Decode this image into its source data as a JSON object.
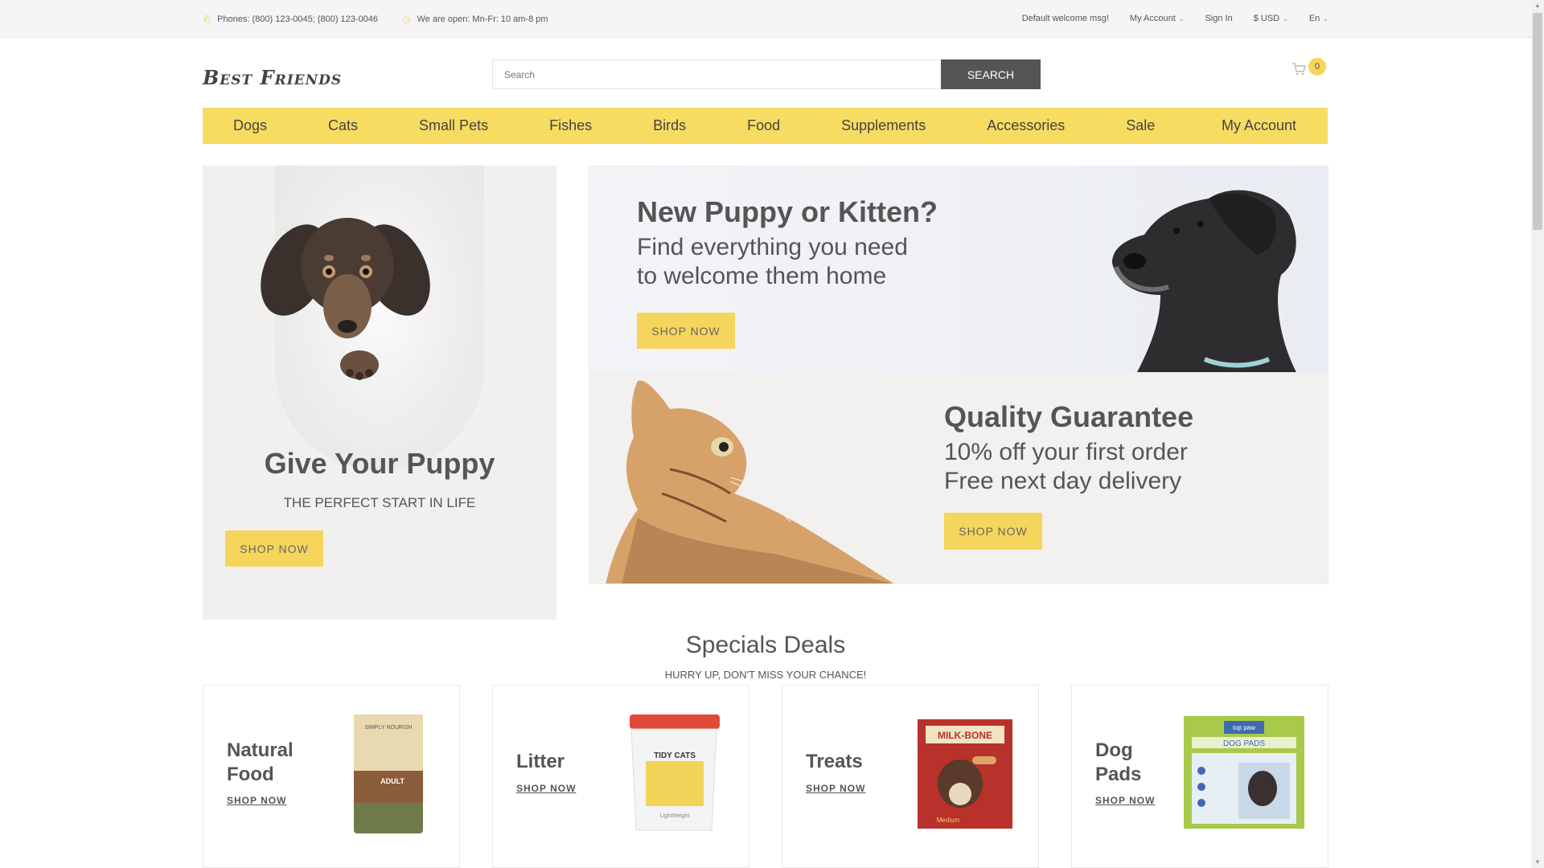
{
  "topbar": {
    "phones": "Phones: (800) 123-0045; (800) 123-0046",
    "hours": "We are open: Mn-Fr: 10 am-8 pm",
    "welcome": "Default welcome msg!",
    "my_account": "My Account",
    "sign_in": "Sign In",
    "currency": "$ USD",
    "language": "En"
  },
  "header": {
    "logo": "Best Friends",
    "search_placeholder": "Search",
    "search_button": "SEARCH",
    "cart_count": "0"
  },
  "nav": {
    "items": [
      "Dogs",
      "Cats",
      "Small Pets",
      "Fishes",
      "Birds",
      "Food",
      "Supplements",
      "Accessories",
      "Sale"
    ],
    "account": "My Account"
  },
  "hero_left": {
    "title": "Give Your Puppy",
    "subtitle": "THE PERFECT START IN LIFE",
    "button": "SHOP NOW"
  },
  "hero_right_top": {
    "title": "New Puppy or Kitten?",
    "line1": "Find everything you need",
    "line2": "to welcome them home",
    "button": "SHOP NOW"
  },
  "hero_right_bottom": {
    "title": "Quality Guarantee",
    "line1": "10% off your first order",
    "line2": "Free next day delivery",
    "button": "SHOP NOW"
  },
  "specials": {
    "title": "Specials Deals",
    "subtitle": "HURRY UP, DON'T MISS YOUR CHANCE!",
    "cards": [
      {
        "title_l1": "Natural",
        "title_l2": "Food",
        "shop": "SHOP NOW",
        "product_label": "SIMPLY NOURISH",
        "product_sub": "ADULT"
      },
      {
        "title_l1": "Litter",
        "title_l2": "",
        "shop": "SHOP NOW",
        "product_label": "TIDY CATS",
        "product_sub": "LightWeight"
      },
      {
        "title_l1": "Treats",
        "title_l2": "",
        "shop": "SHOP NOW",
        "product_label": "MILK-BONE",
        "product_sub": "Medium"
      },
      {
        "title_l1": "Dog",
        "title_l2": "Pads",
        "shop": "SHOP NOW",
        "product_label": "top paw",
        "product_sub": "DOG PADS"
      }
    ]
  },
  "colors": {
    "accent": "#f7dc62",
    "dark_button": "#555555",
    "text": "#555555"
  }
}
